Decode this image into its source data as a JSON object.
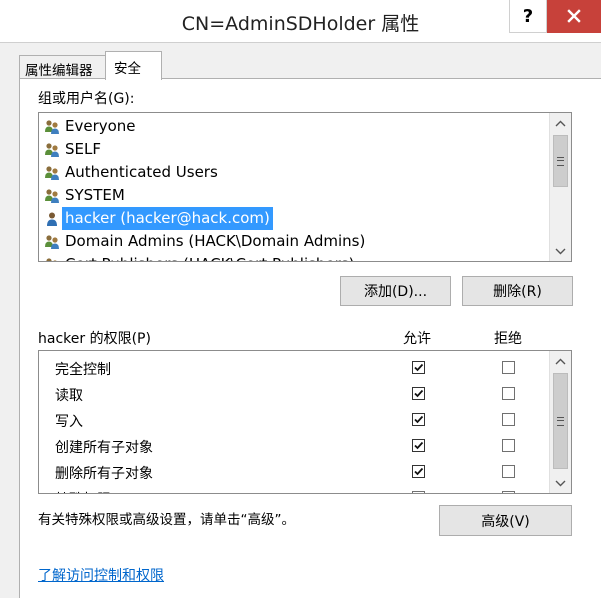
{
  "window": {
    "title": "CN=AdminSDHolder 属性",
    "help_label": "?",
    "close_icon": "close-icon"
  },
  "tabs": [
    {
      "label": "属性编辑器",
      "active": false
    },
    {
      "label": "安全",
      "active": true
    }
  ],
  "groups": {
    "label": "组或用户名(G):",
    "items": [
      {
        "name": "Everyone",
        "icon": "group-icon",
        "selected": false
      },
      {
        "name": "SELF",
        "icon": "group-icon",
        "selected": false
      },
      {
        "name": "Authenticated Users",
        "icon": "group-icon",
        "selected": false
      },
      {
        "name": "SYSTEM",
        "icon": "group-icon",
        "selected": false
      },
      {
        "name": "hacker (hacker@hack.com)",
        "icon": "user-icon",
        "selected": true
      },
      {
        "name": "Domain Admins (HACK\\Domain Admins)",
        "icon": "group-icon",
        "selected": false
      },
      {
        "name": "Cert Publishers (HACK\\Cert Publishers)",
        "icon": "group-icon",
        "selected": false
      }
    ]
  },
  "buttons": {
    "add": "添加(D)...",
    "remove": "删除(R)",
    "advanced": "高级(V)"
  },
  "permissions": {
    "label": "hacker 的权限(P)",
    "allow_header": "允许",
    "deny_header": "拒绝",
    "rows": [
      {
        "name": "完全控制",
        "allow": true,
        "deny": false
      },
      {
        "name": "读取",
        "allow": true,
        "deny": false
      },
      {
        "name": "写入",
        "allow": true,
        "deny": false
      },
      {
        "name": "创建所有子对象",
        "allow": true,
        "deny": false
      },
      {
        "name": "删除所有子对象",
        "allow": true,
        "deny": false
      },
      {
        "name": "特殊权限",
        "allow": false,
        "deny": false
      }
    ]
  },
  "advanced_hint": "有关特殊权限或高级设置，请单击“高级”。",
  "help_link": "了解访问控制和权限",
  "colors": {
    "selection": "#3399ff",
    "close_button": "#c7413a",
    "link": "#0066cc"
  }
}
